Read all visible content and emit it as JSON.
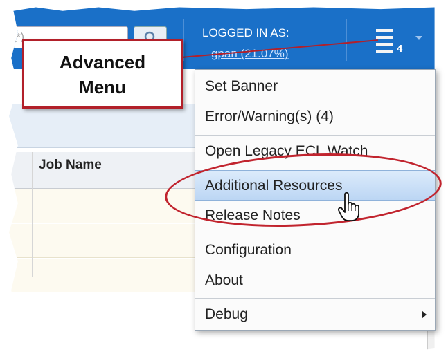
{
  "header": {
    "search_placeholder": "*",
    "login_label": "LOGGED IN AS:",
    "login_user": "gpan (21.07%)",
    "advanced_count": "4"
  },
  "callout": {
    "line1": "Advanced",
    "line2": "Menu"
  },
  "grid": {
    "column_job_name": "Job Name"
  },
  "menu": {
    "items": [
      {
        "label": "Set Banner"
      },
      {
        "label": "Error/Warning(s) (4)"
      },
      {
        "label": "Open Legacy ECL Watch"
      },
      {
        "label": "Additional Resources"
      },
      {
        "label": "Release Notes"
      },
      {
        "label": "Configuration"
      },
      {
        "label": "About"
      },
      {
        "label": "Debug"
      }
    ],
    "hovered_item": "Additional Resources"
  },
  "colors": {
    "topbar": "#1a70c8",
    "highlight_red": "#c1242e",
    "menu_hover": "#bcd6f4"
  },
  "icons": [
    "search-icon",
    "advanced-menu-icon",
    "caret-down-icon",
    "submenu-arrow-icon",
    "hand-cursor-icon"
  ]
}
